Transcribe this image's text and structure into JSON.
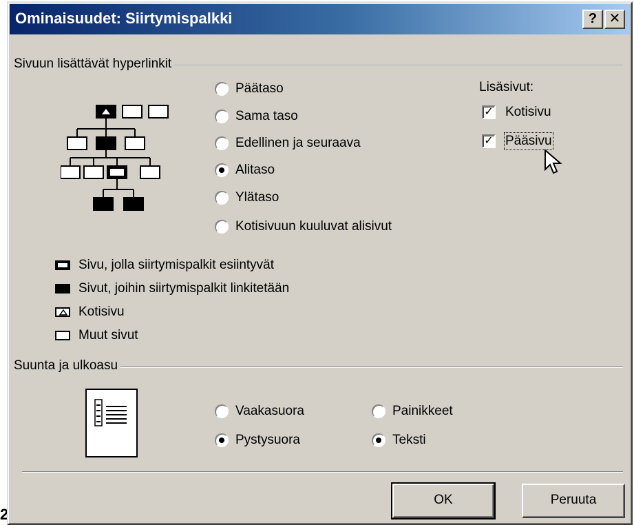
{
  "window": {
    "title": "Ominaisuudet: Siirtymispalkki",
    "help_button": "?",
    "close_button": "✕"
  },
  "margin_marks": [
    "/",
    "2"
  ],
  "links_group": {
    "label": "Sivuun lisättävät hyperlinkit",
    "options": [
      {
        "label": "Päätaso",
        "checked": false
      },
      {
        "label": "Sama taso",
        "checked": false
      },
      {
        "label": "Edellinen ja seuraava",
        "checked": false
      },
      {
        "label": "Alitaso",
        "checked": true
      },
      {
        "label": "Ylätaso",
        "checked": false
      },
      {
        "label": "Kotisivuun kuuluvat alisivut",
        "checked": false
      }
    ],
    "extra_pages": {
      "label": "Lisäsivut:",
      "items": [
        {
          "label": "Kotisivu",
          "checked": true
        },
        {
          "label": "Pääsivu",
          "checked": true
        }
      ]
    }
  },
  "legend": [
    {
      "label": "Sivu, jolla siirtymispalkit esiintyvät",
      "icon": "current-page-icon"
    },
    {
      "label": "Sivut, joihin siirtymispalkit linkitetään",
      "icon": "linked-pages-icon"
    },
    {
      "label": "Kotisivu",
      "icon": "home-page-icon"
    },
    {
      "label": "Muut sivut",
      "icon": "other-pages-icon"
    }
  ],
  "layout_group": {
    "label": "Suunta ja ulkoasu",
    "orientation": [
      {
        "label": "Vaakasuora",
        "checked": false
      },
      {
        "label": "Pystysuora",
        "checked": true
      }
    ],
    "appearance": [
      {
        "label": "Painikkeet",
        "checked": false
      },
      {
        "label": "Teksti",
        "checked": true
      }
    ]
  },
  "buttons": {
    "ok": "OK",
    "cancel": "Peruuta"
  },
  "colors": {
    "dialog_bg": "#d4d0c8",
    "title_start": "#08246b",
    "title_end": "#a6caf0"
  }
}
